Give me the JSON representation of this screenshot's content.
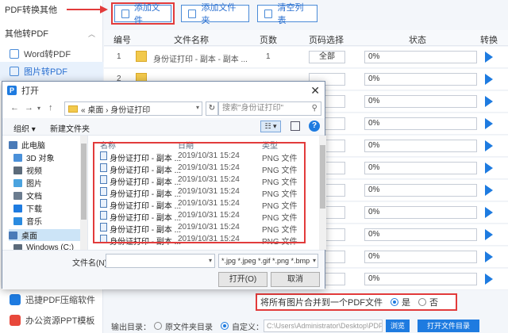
{
  "sidebar": {
    "section1": "PDF转换其他",
    "section2": "其他转PDF",
    "items": [
      {
        "label": "Word转PDF"
      },
      {
        "label": "图片转PDF"
      }
    ],
    "bottom_items": [
      {
        "label": "迅捷PDF压缩软件",
        "color": "#1e7be0"
      },
      {
        "label": "办公资源PPT模板",
        "color": "#e8483b"
      }
    ]
  },
  "toolbar": {
    "add_file": "添加文件",
    "add_folder": "添加文件夹",
    "clear_list": "清空列表"
  },
  "table": {
    "headers": [
      "编号",
      "文件名称",
      "页数",
      "页码选择",
      "状态",
      "转换"
    ],
    "rows": [
      {
        "num": "1",
        "name": "身份证打印 - 副本 - 副本 ...",
        "pages": "1",
        "range": "全部",
        "progress": "0%"
      },
      {
        "num": "2",
        "name": "",
        "pages": "",
        "range": "",
        "progress": "0%"
      },
      {
        "num": "",
        "name": "",
        "pages": "",
        "range": "",
        "progress": "0%"
      },
      {
        "num": "",
        "name": "",
        "pages": "",
        "range": "",
        "progress": "0%"
      },
      {
        "num": "",
        "name": "",
        "pages": "",
        "range": "",
        "progress": "0%"
      },
      {
        "num": "",
        "name": "",
        "pages": "",
        "range": "",
        "progress": "0%"
      },
      {
        "num": "",
        "name": "",
        "pages": "",
        "range": "",
        "progress": "0%"
      },
      {
        "num": "",
        "name": "",
        "pages": "",
        "range": "",
        "progress": "0%"
      },
      {
        "num": "",
        "name": "",
        "pages": "",
        "range": "",
        "progress": "0%"
      },
      {
        "num": "",
        "name": "",
        "pages": "",
        "range": "",
        "progress": "0%"
      },
      {
        "num": "",
        "name": "",
        "pages": "",
        "range": "",
        "progress": "0%"
      }
    ]
  },
  "merge": {
    "label": "将所有图片合并到一个PDF文件",
    "yes": "是",
    "no": "否"
  },
  "output": {
    "label": "输出目录：",
    "opt1": "原文件夹目录",
    "opt2": "自定义：",
    "path": "C:\\Users\\Administrator\\Desktop\\PDF转换",
    "browse": "浏览",
    "start": "打开文件目录"
  },
  "dialog": {
    "title": "打开",
    "breadcrumb": "«  桌面  ›  身份证打印",
    "search_placeholder": "搜索\"身份证打印\"",
    "organize": "组织 ▾",
    "new_folder": "新建文件夹",
    "tree": [
      {
        "label": "此电脑",
        "color": "#4a7bb8"
      },
      {
        "label": "3D 对象",
        "color": "#4a90d9"
      },
      {
        "label": "视频",
        "color": "#5c6b7a"
      },
      {
        "label": "图片",
        "color": "#4aa3df"
      },
      {
        "label": "文档",
        "color": "#6b7c8f"
      },
      {
        "label": "下载",
        "color": "#1e7be0"
      },
      {
        "label": "音乐",
        "color": "#2a8be0"
      },
      {
        "label": "桌面",
        "color": "#4a7bb8"
      },
      {
        "label": "Windows (C:)",
        "color": "#5c6b7a"
      }
    ],
    "columns": [
      "名称",
      "日期",
      "类型"
    ],
    "files": [
      {
        "name": "身份证打印 - 副本 ...",
        "date": "2019/10/31 15:24",
        "type": "PNG 文件"
      },
      {
        "name": "身份证打印 - 副本 ...",
        "date": "2019/10/31 15:24",
        "type": "PNG 文件"
      },
      {
        "name": "身份证打印 - 副本 ...",
        "date": "2019/10/31 15:24",
        "type": "PNG 文件"
      },
      {
        "name": "身份证打印 - 副本 ...",
        "date": "2019/10/31 15:24",
        "type": "PNG 文件"
      },
      {
        "name": "身份证打印 - 副本 ...",
        "date": "2019/10/31 15:24",
        "type": "PNG 文件"
      },
      {
        "name": "身份证打印 - 副本 ...",
        "date": "2019/10/31 15:24",
        "type": "PNG 文件"
      },
      {
        "name": "身份证打印 - 副本 ...",
        "date": "2019/10/31 15:24",
        "type": "PNG 文件"
      },
      {
        "name": "身份证打印 - 副本 ...",
        "date": "2019/10/31 15:24",
        "type": "PNG 文件"
      }
    ],
    "filename_label": "文件名(N):",
    "filename_value": "",
    "filter": "*.jpg *.jpeg *.gif *.png *.bmp",
    "open": "打开(O)",
    "cancel": "取消"
  }
}
